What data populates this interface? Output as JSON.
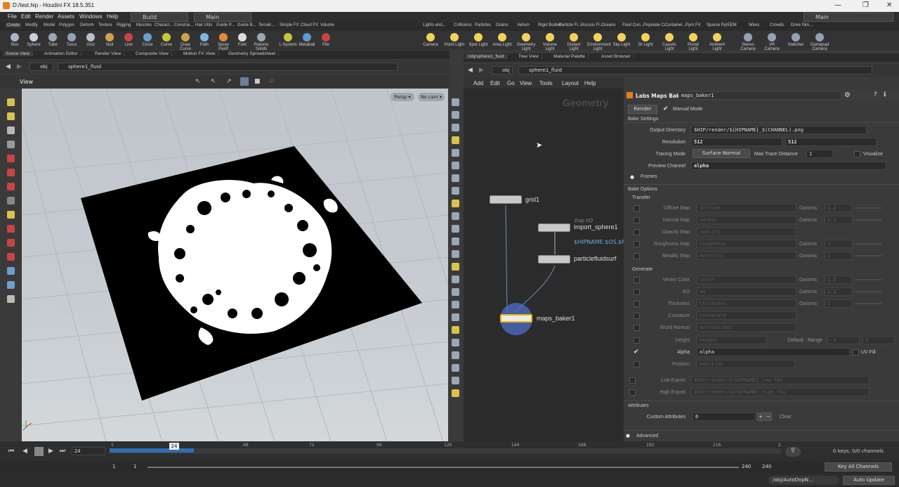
{
  "window": {
    "title": "D:/test.hip - Houdini FX 18.5.351"
  },
  "menu": {
    "items": [
      "File",
      "Edit",
      "Render",
      "Assets",
      "Windows",
      "Help"
    ],
    "desktop": "Build",
    "context": "Main",
    "right_desktop": "Main"
  },
  "shelf_tabs_left": [
    "Create",
    "Modify",
    "Model",
    "Polygon",
    "Deform",
    "Texture",
    "Rigging",
    "Muscles",
    "Charact...",
    "Constrai...",
    "Hair Utils",
    "Guide P...",
    "Guide B...",
    "Terrain...",
    "Simple FX",
    "Cloud FX",
    "Volume"
  ],
  "shelf_tabs_right": [
    "Lights and...",
    "Collisions",
    "Particles",
    "Grains",
    "Vellum",
    "Rigid Bodies",
    "Particle Fl...",
    "Viscous Fl...",
    "Oceans",
    "Fluid Con...",
    "Populate C...",
    "Container...",
    "Pyro FX",
    "Sparse Pyr...",
    "FEM",
    "Wires",
    "Crowds",
    "Drive Sim..."
  ],
  "shelf_tools_left": [
    "Box",
    "Sphere",
    "Tube",
    "Torus",
    "Grid",
    "Null",
    "Line",
    "Circle",
    "Curve",
    "Draw Curve",
    "Path",
    "Spray Paint",
    "Font",
    "Platonic Solids",
    "L-System",
    "Metaball",
    "File"
  ],
  "shelf_tools_right": [
    "Camera",
    "Point Light",
    "Spot Light",
    "Area Light",
    "Geometry Light",
    "Volume Light",
    "Distant Light",
    "Environment Light",
    "Sky Light",
    "GI Light",
    "Caustic Light",
    "Portal Light",
    "Ambient Light",
    "Stereo Camera",
    "VR Camera",
    "Switcher",
    "Gamepad Camera"
  ],
  "left_pane_tabs": [
    "Scene View",
    "Animation Editor",
    "Render View",
    "Composite View",
    "Motion FX View",
    "Geometry Spreadsheet"
  ],
  "right_pane_tabs": [
    "/obj/sphere1_fluid",
    "Tree View",
    "Material Palette",
    "Asset Browser"
  ],
  "left_path": {
    "obj": "obj",
    "node": "sphere1_fluid"
  },
  "right_path": {
    "obj": "obj",
    "node": "sphere1_fluid"
  },
  "viewport": {
    "label": "View",
    "persp": "Persp ▾",
    "cam": "No cam ▾"
  },
  "net_menu": [
    "Add",
    "Edit",
    "Go",
    "View",
    "Tools",
    "Layout",
    "Help"
  ],
  "network": {
    "watermark": "Geometry",
    "nodes": [
      {
        "name": "grid1"
      },
      {
        "name": "import_sphere1",
        "context": "Dop I/O",
        "expr": "$HIPNAME.$OS.$F"
      },
      {
        "name": "particlefluidsurf"
      },
      {
        "name": "maps_baker1"
      }
    ]
  },
  "parm_header": {
    "type": "Labs Maps Baker",
    "name": "maps_baker1"
  },
  "parms": {
    "render_btn": "Render",
    "manual_mode": "Manual Mode",
    "bake_settings": "Bake Settings",
    "output_dir_lbl": "Output Directory",
    "output_dir": "$HIP/render/${HIPNAME}_$(CHANNEL).png",
    "res_lbl": "Resolution",
    "res_x": "512",
    "res_y": "512",
    "tracing_lbl": "Tracing Mode",
    "tracing": "Surface Normal",
    "max_trace_lbl": "Max Trace Distance",
    "max_trace": "1",
    "visualize": "Visualize",
    "preview_lbl": "Preview Channel",
    "preview": "alpha",
    "frames": "Frames",
    "bake_options": "Bake Options",
    "transfer": "Transfer",
    "transfer_rows": [
      {
        "label": "Diffuse Map",
        "value": "diffuse",
        "gamma": "2.2"
      },
      {
        "label": "Normal Map",
        "value": "normal",
        "gamma": "2.2"
      },
      {
        "label": "Opacity Map",
        "value": "opacity",
        "gamma": ""
      },
      {
        "label": "Roughness Map",
        "value": "roughness",
        "gamma": "1"
      },
      {
        "label": "Metallic Map",
        "value": "metallic",
        "gamma": "1"
      }
    ],
    "gamma_lbl": "Gamma",
    "generate": "Generate",
    "generate_rows": [
      {
        "label": "Vertex Color",
        "value": "color",
        "gamma": "2.2"
      },
      {
        "label": "AO",
        "value": "ao",
        "gamma": "2.2"
      },
      {
        "label": "Thickness",
        "value": "thickness",
        "gamma": "1"
      },
      {
        "label": "Curvature",
        "value": "curvature",
        "gamma": ""
      },
      {
        "label": "World Normal",
        "value": "worldnormal",
        "gamma": ""
      }
    ],
    "height_lbl": "Height",
    "height_val": "height",
    "height_default": "Default",
    "range_lbl": "Range",
    "range_a": "-1",
    "range_b": "1",
    "alpha_lbl": "Alpha",
    "alpha_val": "alpha",
    "uv_fill": "UV Fill",
    "position_lbl": "Position",
    "position_val": "position",
    "low_export_lbl": "Low Export",
    "low_export": "$HIP/render/${HIPNAME}_low.fbx",
    "high_export_lbl": "High Export",
    "high_export": "$HIP/render/${HIPNAME}_high.fbx",
    "attributes": "Attributes",
    "custom_attr_lbl": "Custom Attributes",
    "custom_attr": "0",
    "clear": "Clear",
    "advanced": "Advanced"
  },
  "timeline": {
    "frame": "24",
    "current": "24",
    "ticks": [
      "1",
      "24",
      "48",
      "72",
      "96",
      "120",
      "144",
      "168",
      "192",
      "216",
      "2"
    ],
    "start": "1",
    "start2": "1",
    "end": "240",
    "end2": "240",
    "channels": "0 keys, 0/0 channels",
    "key_all": "Key All Channels"
  },
  "status": {
    "path": "/obj/AutoDopN...",
    "auto_update": "Auto Update"
  }
}
